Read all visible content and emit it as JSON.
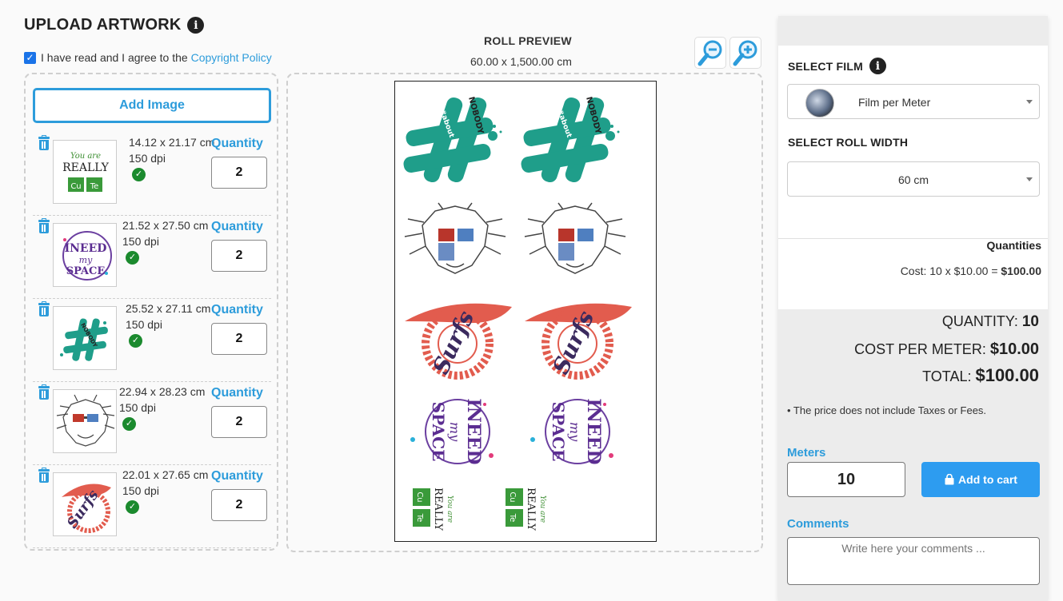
{
  "header": {
    "title": "UPLOAD ARTWORK",
    "agree_text": "I have read and I agree to the ",
    "policy_link": "Copyright Policy"
  },
  "upload": {
    "add_image_label": "Add Image",
    "quantity_label": "Quantity",
    "items": [
      {
        "dims": "14.12 x 21.17 cm",
        "dpi": "150 dpi",
        "quantity": "2"
      },
      {
        "dims": "21.52 x 27.50 cm",
        "dpi": "150 dpi",
        "quantity": "2"
      },
      {
        "dims": "25.52 x 27.11 cm",
        "dpi": "150 dpi",
        "quantity": "2"
      },
      {
        "dims": "22.94 x 28.23 cm",
        "dpi": "150 dpi",
        "quantity": "2"
      },
      {
        "dims": "22.01 x 27.65 cm",
        "dpi": "150 dpi",
        "quantity": "2"
      }
    ]
  },
  "preview": {
    "title": "ROLL PREVIEW",
    "dims": "60.00 x 1,500.00 cm"
  },
  "order": {
    "film_label": "SELECT FILM",
    "film_value": "Film per Meter",
    "width_label": "SELECT ROLL WIDTH",
    "width_value": "60 cm",
    "quantities_heading": "Quantities",
    "cost_prefix": "Cost: 10 x $10.00 = ",
    "cost_total": "$100.00",
    "quantity_label": "QUANTITY: ",
    "quantity_value": "10",
    "cpm_label": "COST PER METER: ",
    "cpm_value": "$10.00",
    "total_label": "TOTAL: ",
    "total_value": "$100.00",
    "note": "• The price does not include Taxes or Fees.",
    "meters_label": "Meters",
    "meters_value": "10",
    "add_to_cart": "Add to cart",
    "comments_label": "Comments",
    "comments_placeholder": "Write here your comments ..."
  },
  "colors": {
    "accent": "#2d9cdb",
    "button": "#2d9cf0",
    "check_green": "#1b8a2e"
  }
}
